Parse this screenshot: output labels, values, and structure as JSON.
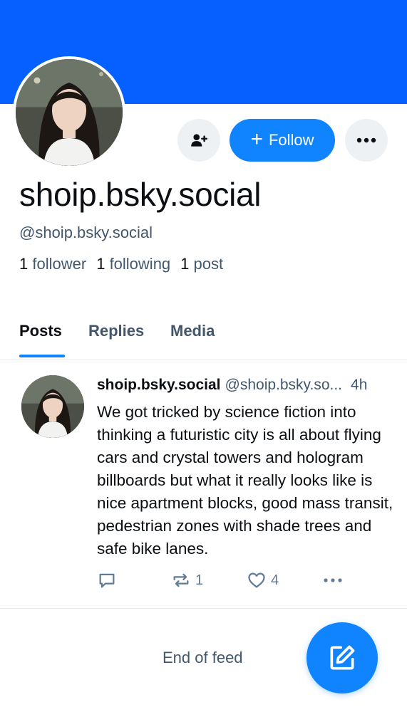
{
  "profile": {
    "display_name": "shoip.bsky.social",
    "handle": "@shoip.bsky.social",
    "stats": {
      "followers_count": "1",
      "followers_label": "follower",
      "following_count": "1",
      "following_label": "following",
      "posts_count": "1",
      "posts_label": "post"
    },
    "follow_label": "Follow"
  },
  "tabs": [
    {
      "label": "Posts",
      "active": true
    },
    {
      "label": "Replies",
      "active": false
    },
    {
      "label": "Media",
      "active": false
    }
  ],
  "post": {
    "author": "shoip.bsky.social",
    "handle": "@shoip.bsky.so...",
    "time": "4h",
    "text": "We got tricked by science fiction into thinking a futuristic city is all about flying cars and crystal towers and hologram billboards but what it really looks like is nice apartment blocks, good mass transit, pedestrian zones with shade trees and safe bike lanes.",
    "repost_count": "1",
    "like_count": "4"
  },
  "feed": {
    "end_label": "End of feed"
  },
  "icons": {
    "add_user": "add-user-icon",
    "plus": "plus-icon",
    "more": "more-icon",
    "reply": "reply-icon",
    "repost": "repost-icon",
    "like": "heart-icon",
    "compose": "compose-icon"
  },
  "colors": {
    "banner": "#0560ff",
    "accent": "#1083fe",
    "muted_text": "#42576c",
    "action_icon": "#607b96",
    "button_bg": "#eef1f4"
  }
}
